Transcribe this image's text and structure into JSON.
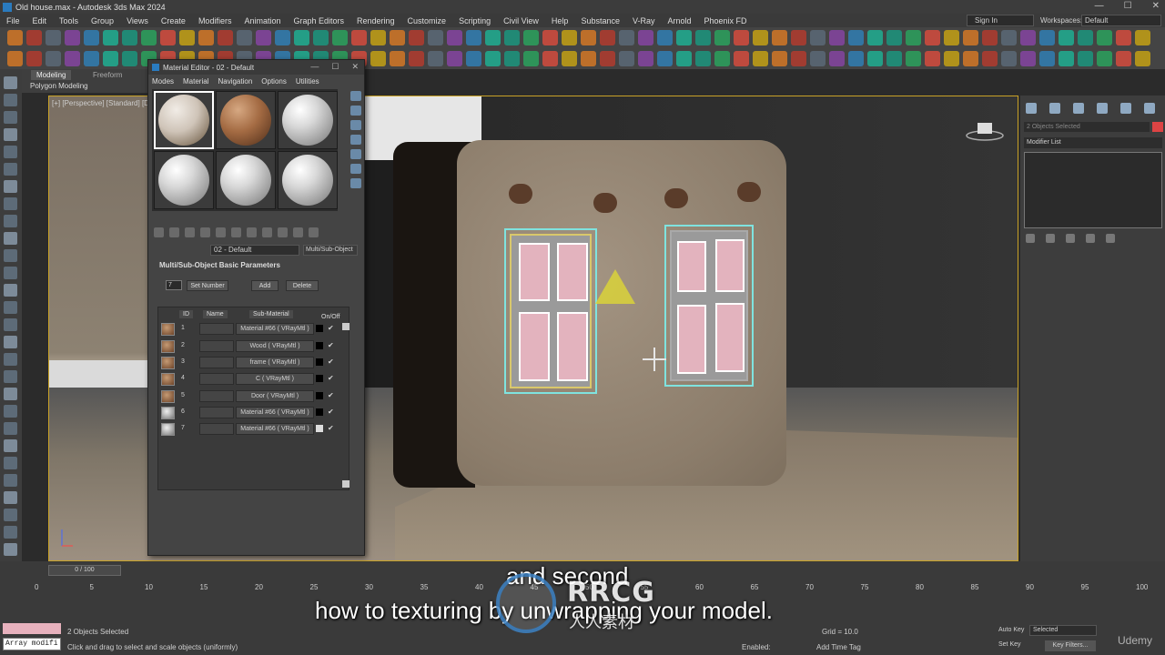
{
  "window": {
    "title": "Old house.max - Autodesk 3ds Max 2024",
    "controls": [
      "—",
      "☐",
      "✕"
    ]
  },
  "menu": [
    "File",
    "Edit",
    "Tools",
    "Group",
    "Views",
    "Create",
    "Modifiers",
    "Animation",
    "Graph Editors",
    "Rendering",
    "Customize",
    "Scripting",
    "Civil View",
    "Help",
    "Substance",
    "V-Ray",
    "Arnold",
    "Phoenix FD"
  ],
  "account": {
    "signin": "Sign In",
    "workspaces_label": "Workspaces:",
    "workspace": "Default"
  },
  "ribbon": {
    "tab_modeling": "Modeling",
    "tab_freeform": "Freeform",
    "sub": "Polygon Modeling"
  },
  "viewport": {
    "label": "[+] [Perspective] [Standard] [Default Shading]"
  },
  "material_editor": {
    "title": "Material Editor - 02 - Default",
    "menu": [
      "Modes",
      "Material",
      "Navigation",
      "Options",
      "Utilities"
    ],
    "material_name": "02 - Default",
    "material_type": "Multi/Sub-Object",
    "rollout": "Multi/Sub-Object Basic Parameters",
    "count": "7",
    "set_number": "Set Number",
    "add": "Add",
    "delete": "Delete",
    "headers": {
      "id": "ID",
      "name": "Name",
      "sub": "Sub-Material",
      "onoff": "On/Off"
    },
    "rows": [
      {
        "id": "1",
        "sub": "Material #66 ( VRayMtl )",
        "check": "✔"
      },
      {
        "id": "2",
        "sub": "Wood ( VRayMtl )",
        "check": "✔"
      },
      {
        "id": "3",
        "sub": "frame ( VRayMtl )",
        "check": "✔"
      },
      {
        "id": "4",
        "sub": "C ( VRayMtl )",
        "check": "✔"
      },
      {
        "id": "5",
        "sub": "Door ( VRayMtl )",
        "check": "✔"
      },
      {
        "id": "6",
        "sub": "Material #66 ( VRayMtl )",
        "check": "✔"
      },
      {
        "id": "7",
        "sub": "Material #66 ( VRayMtl )",
        "check": "✔"
      }
    ]
  },
  "command_panel": {
    "selection": "2 Objects Selected",
    "modifier_list": "Modifier List"
  },
  "timeline": {
    "frame": "0 / 100",
    "ticks": [
      "0",
      "5",
      "10",
      "15",
      "20",
      "25",
      "30",
      "35",
      "40",
      "45",
      "50",
      "55",
      "60",
      "65",
      "70",
      "75",
      "80",
      "85",
      "90",
      "95",
      "100"
    ]
  },
  "status": {
    "maxscript": "Array modifi",
    "selected": "2 Objects Selected",
    "prompt": "Click and drag to select and scale objects (uniformly)",
    "grid": "Grid = 10.0",
    "enabled": "Enabled:",
    "add_time_tag": "Add Time Tag",
    "autokey": "Auto Key",
    "setkey": "Set Key",
    "selected_dd": "Selected",
    "keyfilters": "Key Filters..."
  },
  "subtitles": {
    "line1": "and second",
    "line2": "how to texturing by unwrapping your model."
  },
  "watermark": {
    "text": "RRCG",
    "sub": "人人素材"
  },
  "brand": "Udemy",
  "colors": {
    "accent": "#2a7bbf",
    "selection": "#7fe3df",
    "viewport_border": "#c9a227"
  }
}
